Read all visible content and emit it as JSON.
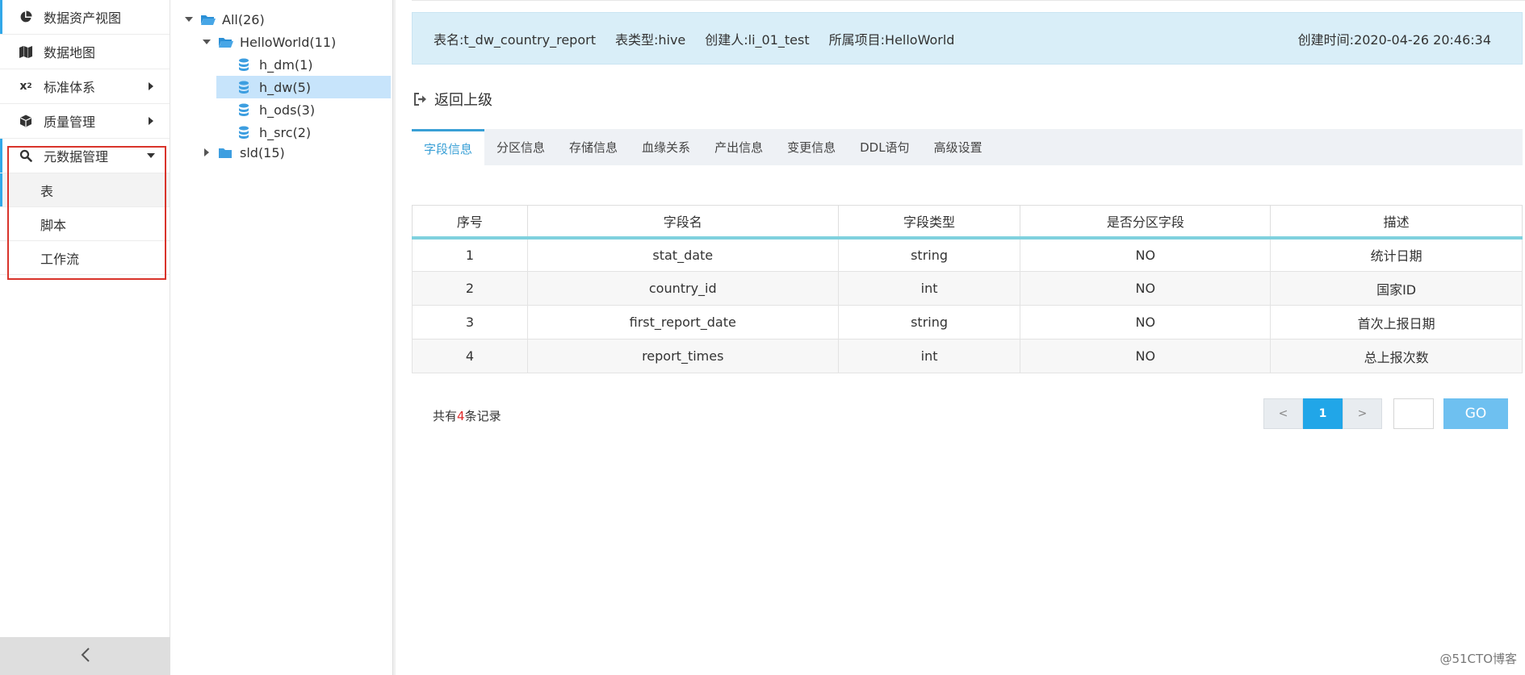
{
  "nav": {
    "items": [
      {
        "label": "数据资产视图",
        "icon": "pie-chart-icon"
      },
      {
        "label": "数据地图",
        "icon": "map-icon"
      },
      {
        "label": "标准体系",
        "icon": "subscript-icon"
      },
      {
        "label": "质量管理",
        "icon": "cube-icon"
      },
      {
        "label": "元数据管理",
        "icon": "search-icon"
      }
    ],
    "sub_items": [
      {
        "label": "表"
      },
      {
        "label": "脚本"
      },
      {
        "label": "工作流"
      }
    ]
  },
  "tree": {
    "root": "All(26)",
    "group": "HelloWorld(11)",
    "children": [
      "h_dm(1)",
      "h_dw(5)",
      "h_ods(3)",
      "h_src(2)"
    ],
    "sibling": "sld(15)"
  },
  "info": {
    "table_name": "表名:t_dw_country_report",
    "table_type": "表类型:hive",
    "creator": "创建人:li_01_test",
    "project": "所属项目:HelloWorld",
    "created_time": "创建时间:2020-04-26 20:46:34"
  },
  "back_label": "返回上级",
  "tabs": [
    "字段信息",
    "分区信息",
    "存储信息",
    "血缘关系",
    "产出信息",
    "变更信息",
    "DDL语句",
    "高级设置"
  ],
  "table": {
    "headers": [
      "序号",
      "字段名",
      "字段类型",
      "是否分区字段",
      "描述"
    ],
    "rows": [
      [
        "1",
        "stat_date",
        "string",
        "NO",
        "统计日期"
      ],
      [
        "2",
        "country_id",
        "int",
        "NO",
        "国家ID"
      ],
      [
        "3",
        "first_report_date",
        "string",
        "NO",
        "首次上报日期"
      ],
      [
        "4",
        "report_times",
        "int",
        "NO",
        "总上报次数"
      ]
    ]
  },
  "footer": {
    "prefix": "共有",
    "count": "4",
    "suffix": "条记录"
  },
  "pager": {
    "prev": "<",
    "current": "1",
    "next": ">",
    "go": "GO"
  },
  "watermark": "@51CTO博客",
  "colors": {
    "accent": "#21a6e8",
    "info_bar": "#d9eef8",
    "tab_active": "#3aa0d6",
    "highlight_box": "#d9342b"
  }
}
